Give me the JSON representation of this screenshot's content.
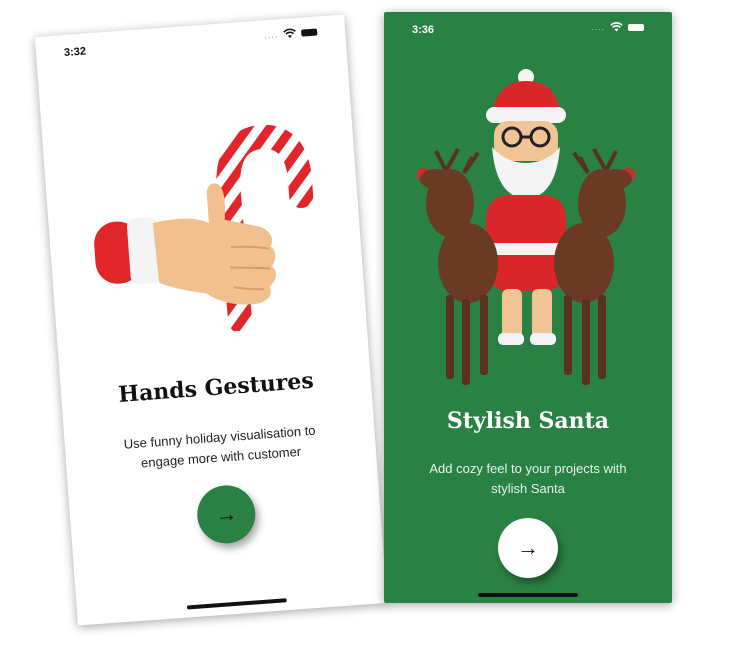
{
  "screens": [
    {
      "time": "3:32",
      "title": "Hands Gestures",
      "subtitle_lines": [
        "Use funny holiday visualisation to",
        "engage more with customer"
      ],
      "next_icon": "→",
      "illustration_icon": "hand-holding-candy-cane-icon",
      "background": "#ffffff",
      "button_color": "#2a8144"
    },
    {
      "time": "3:36",
      "title": "Stylish Santa",
      "subtitle_lines": [
        "Add cozy feel to your projects with",
        "stylish Santa"
      ],
      "next_icon": "→",
      "illustration_icon": "santa-with-reindeer-icon",
      "background": "#2a8144",
      "button_color": "#ffffff"
    }
  ]
}
